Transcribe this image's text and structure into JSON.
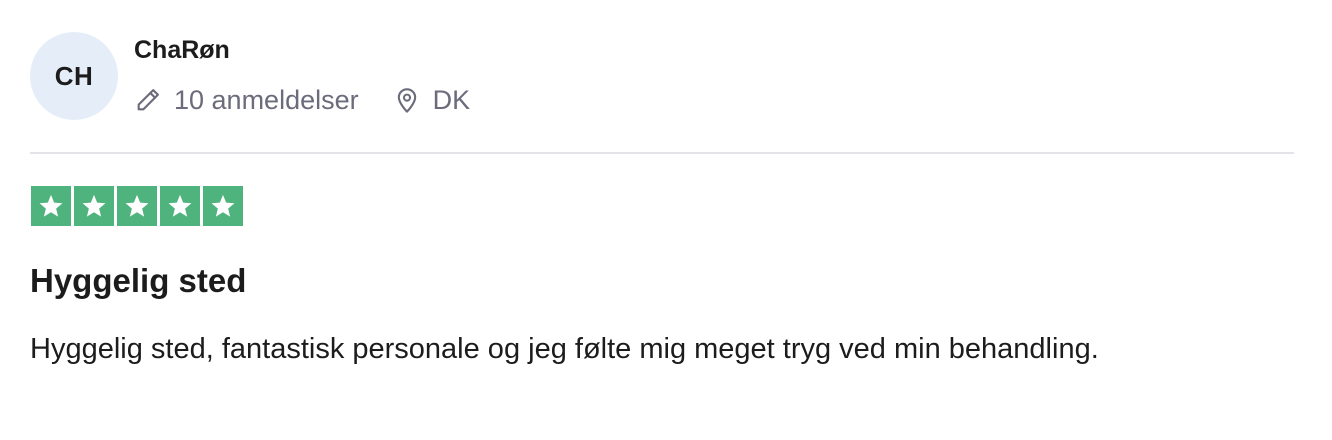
{
  "reviewer": {
    "initials": "CH",
    "name": "ChaRøn",
    "reviews_count_text": "10 anmeldelser",
    "country": "DK",
    "pencil_icon": "pencil-icon",
    "location_icon": "location-pin-icon"
  },
  "rating": {
    "stars": 5,
    "max": 5,
    "color": "#4fb37d"
  },
  "review": {
    "title": "Hyggelig sted",
    "text": "Hyggelig sted, fantastisk personale og jeg følte mig meget tryg ved min behandling."
  }
}
